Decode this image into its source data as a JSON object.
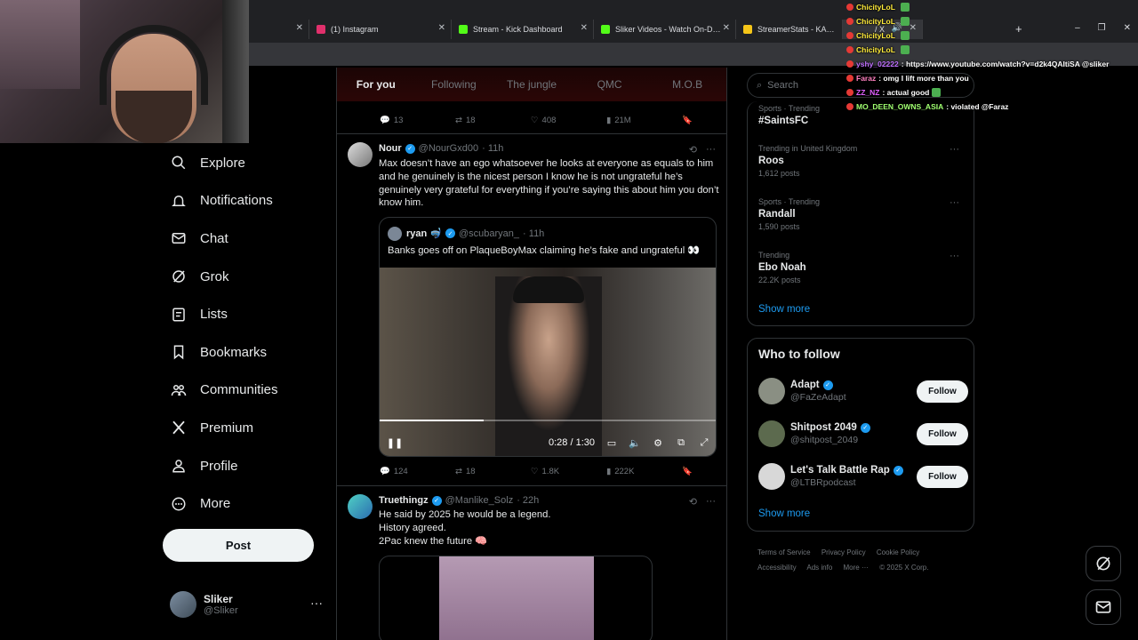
{
  "browser": {
    "tabs": [
      {
        "title": "(1) Instagram",
        "color": "#e1306c"
      },
      {
        "title": "Stream - Kick Dashboard",
        "color": "#53fc18"
      },
      {
        "title": "Sliker Videos - Watch On-Demand",
        "color": "#53fc18"
      },
      {
        "title": "StreamerStats - KALE96's Profile",
        "color": "#f5c518"
      },
      {
        "title": "/ X",
        "color": "#ffffff"
      }
    ],
    "new_tab": "+",
    "window_controls": [
      "–",
      "❐",
      "✕"
    ]
  },
  "nav": {
    "items": [
      {
        "label": "Explore",
        "icon": "search-icon"
      },
      {
        "label": "Notifications",
        "icon": "bell-icon"
      },
      {
        "label": "Chat",
        "icon": "mail-icon"
      },
      {
        "label": "Grok",
        "icon": "grok-icon"
      },
      {
        "label": "Lists",
        "icon": "list-icon"
      },
      {
        "label": "Bookmarks",
        "icon": "bookmark-icon"
      },
      {
        "label": "Communities",
        "icon": "people-icon"
      },
      {
        "label": "Premium",
        "icon": "x-logo-icon"
      },
      {
        "label": "Profile",
        "icon": "person-icon"
      },
      {
        "label": "More",
        "icon": "more-circle-icon"
      }
    ],
    "post_label": "Post",
    "profile": {
      "name": "Sliker",
      "handle": "@Sliker",
      "more": "···"
    }
  },
  "feed": {
    "tabs": [
      {
        "label": "For you",
        "active": true
      },
      {
        "label": "Following",
        "active": false
      },
      {
        "label": "The jungle",
        "active": false
      },
      {
        "label": "QMC",
        "active": false
      },
      {
        "label": "M.O.B",
        "active": false
      }
    ],
    "prev_actions": {
      "replies": "13",
      "reposts": "18",
      "likes": "408",
      "views": "21M"
    },
    "tweet1": {
      "name": "Nour",
      "handle": "@NourGxd00",
      "time": "· 11h",
      "text": "Max doesn’t have an ego whatsoever he looks at everyone as equals to him and he genuinely is the nicest person I know he is not ungrateful he’s genuinely very grateful for everything if you’re saying this about him you don’t know him.",
      "quote": {
        "name": "ryan 🤿",
        "handle": "@scubaryan_",
        "time": "· 11h",
        "text": "Banks goes off on PlaqueBoyMax claiming he’s fake and ungrateful 👀",
        "video_time": "0:28 / 1:30",
        "progress": 0.31
      },
      "actions": {
        "replies": "124",
        "reposts": "18",
        "likes": "1.8K",
        "views": "222K"
      }
    },
    "tweet2": {
      "name": "Truethingz",
      "handle": "@Manlike_Solz",
      "time": "· 22h",
      "lines": [
        "He said by 2025 he would be a legend.",
        "History agreed.",
        "2Pac knew the future 🧠"
      ]
    }
  },
  "sidebar": {
    "search_placeholder": "Search",
    "trends": [
      {
        "meta": "Sports · Trending",
        "name": "#SaintsFC",
        "count": ""
      },
      {
        "meta": "Trending in United Kingdom",
        "name": "Roos",
        "count": "1,612 posts"
      },
      {
        "meta": "Sports · Trending",
        "name": "Randall",
        "count": "1,590 posts"
      },
      {
        "meta": "Trending",
        "name": "Ebo Noah",
        "count": "22.2K posts"
      }
    ],
    "show_more": "Show more",
    "who_to_follow": {
      "title": "Who to follow",
      "accounts": [
        {
          "name": "Adapt",
          "handle": "@FaZeAdapt",
          "color": "#8a8f83"
        },
        {
          "name": "Shitpost 2049",
          "handle": "@shitpost_2049",
          "color": "#5c6a4e"
        },
        {
          "name": "Let's Talk Battle Rap",
          "handle": "@LTBRpodcast",
          "color": "#d8d8d8"
        }
      ],
      "follow_label": "Follow",
      "show_more": "Show more"
    },
    "footer": [
      "Terms of Service",
      "Privacy Policy",
      "Cookie Policy",
      "Accessibility",
      "Ads info",
      "More ···",
      "© 2025 X Corp."
    ]
  },
  "chat": [
    {
      "user": "ChicityLoL",
      "msg": "",
      "color": "#ffeb3b",
      "emote": true
    },
    {
      "user": "ChicityLoL",
      "msg": "",
      "color": "#ffeb3b",
      "emote": true
    },
    {
      "user": "ChicityLoL",
      "msg": "",
      "color": "#ffeb3b",
      "emote": true
    },
    {
      "user": "ChicityLoL",
      "msg": "",
      "color": "#ffeb3b",
      "emote": true
    },
    {
      "user": "yshy_02222",
      "msg": ": https://www.youtube.com/watch?v=d2k4QAItiSA @sliker",
      "color": "#c070ff",
      "emote": false
    },
    {
      "user": "Faraz",
      "msg": ": omg I lift more than you",
      "color": "#ff80c0",
      "emote": false
    },
    {
      "user": "ZZ_NZ",
      "msg": ": actual good",
      "color": "#e060ff",
      "emote": true
    },
    {
      "user": "MO_DEEN_OWNS_ASIA",
      "msg": ": violated @Faraz",
      "color": "#a0ff70",
      "emote": false
    }
  ]
}
